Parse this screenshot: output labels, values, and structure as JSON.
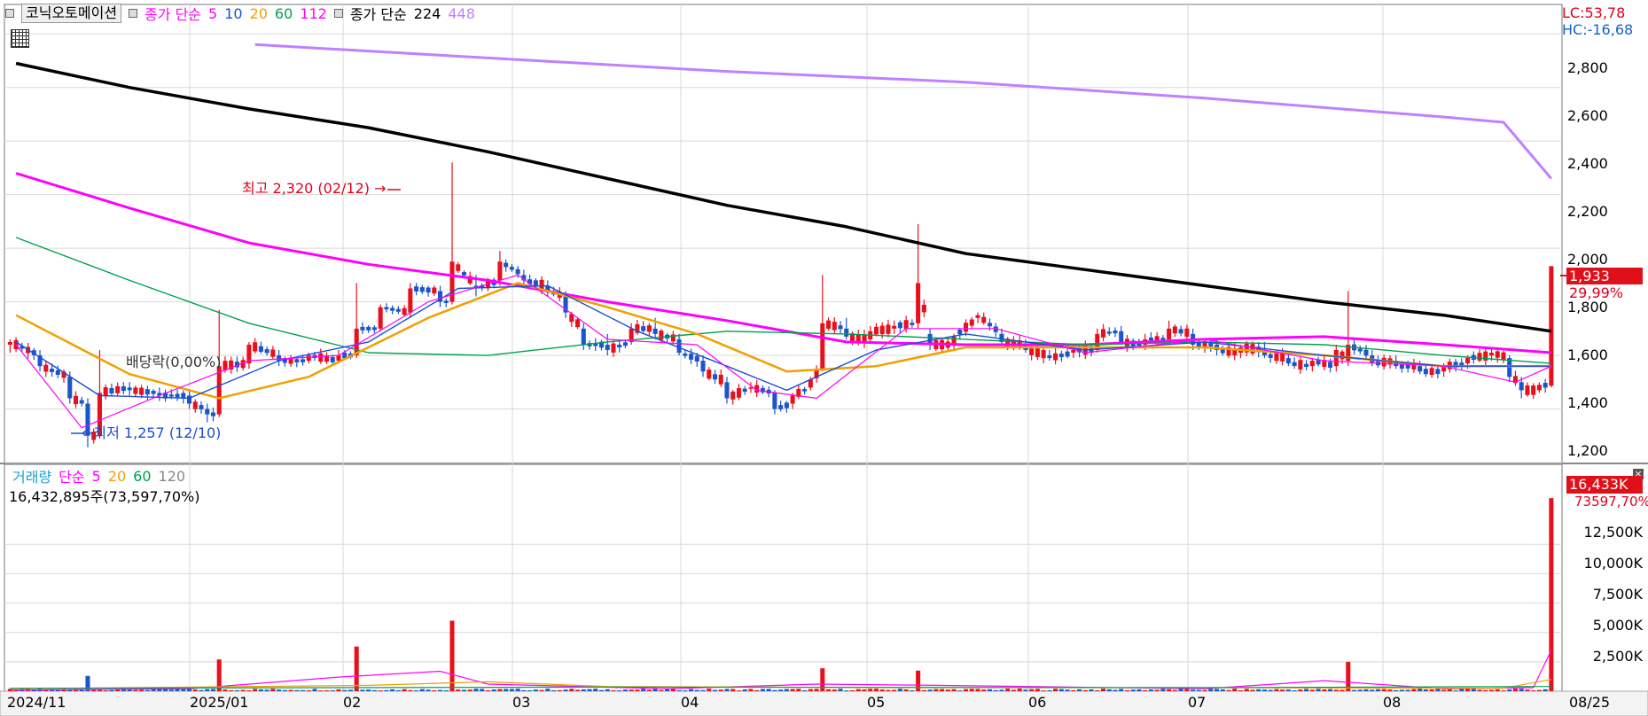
{
  "header": {
    "stock_name": "코닉오토메이션",
    "price_legend": {
      "label": "종가 단순",
      "periods": [
        "5",
        "10",
        "20",
        "60",
        "112"
      ],
      "period_colors": [
        "#ff00ff",
        "#1a4fd6",
        "#f0a000",
        "#00a050",
        "#ff00ff"
      ]
    },
    "price_legend2": {
      "label": "종가 단순",
      "periods": [
        "224",
        "448"
      ],
      "period_colors": [
        "#000000",
        "#c080ff"
      ]
    },
    "lc": "LC:53,78",
    "hc": "HC:-16,68"
  },
  "price_panel": {
    "last_price": "1,933",
    "change_pct": "29,99%",
    "y_ticks": [
      "2,800",
      "2,600",
      "2,400",
      "2,200",
      "2,000",
      "1,800",
      "1,600",
      "1,400",
      "1,200"
    ],
    "annotations": {
      "high": "최고 2,320 (02/12) →",
      "low": "←최저 1,257 (12/10)",
      "dividend": "배당락(0,00%)"
    }
  },
  "volume_panel": {
    "legend_label": "거래량",
    "ma_label": "단순",
    "ma_periods": [
      "5",
      "20",
      "60",
      "120"
    ],
    "ma_colors": [
      "#ff00ff",
      "#f0a000",
      "#00a050",
      "#888888"
    ],
    "info": "16,432,895주(73,597,70%)",
    "last_volume": "16,433K",
    "volume_pct": "73597,70%",
    "y_ticks": [
      "12,500K",
      "10,000K",
      "7,500K",
      "5,000K",
      "2,500K"
    ]
  },
  "x_axis": {
    "labels": [
      "2024/11",
      "2025/01",
      "02",
      "03",
      "04",
      "05",
      "06",
      "07",
      "08",
      "08/25"
    ]
  },
  "colors": {
    "up": "#e8101a",
    "down": "#1a55cc",
    "ma5": "#ff00ff",
    "ma10": "#1a4fd6",
    "ma20": "#f0a000",
    "ma60": "#00a050",
    "ma112": "#ff00ff",
    "ma224": "#000000",
    "ma448": "#c080ff",
    "grid": "#d8d8d8"
  },
  "chart_data": {
    "type": "candlestick",
    "title": "",
    "ylim": [
      1200,
      2900
    ],
    "volume_ylim": [
      0,
      17500
    ],
    "volume_unit": "K",
    "sessions": 205,
    "ohlc_anchors": [
      {
        "i": 0,
        "o": 1640,
        "h": 1660,
        "l": 1610,
        "c": 1650
      },
      {
        "i": 5,
        "o": 1600,
        "h": 1620,
        "l": 1540,
        "c": 1560
      },
      {
        "i": 10,
        "o": 1520,
        "h": 1540,
        "l": 1420,
        "c": 1440
      },
      {
        "i": 13,
        "o": 1420,
        "h": 1440,
        "l": 1257,
        "c": 1300
      },
      {
        "i": 15,
        "o": 1300,
        "h": 1620,
        "l": 1290,
        "c": 1460
      },
      {
        "i": 20,
        "o": 1480,
        "h": 1500,
        "l": 1450,
        "c": 1470
      },
      {
        "i": 25,
        "o": 1460,
        "h": 1480,
        "l": 1430,
        "c": 1450
      },
      {
        "i": 30,
        "o": 1450,
        "h": 1470,
        "l": 1400,
        "c": 1420
      },
      {
        "i": 33,
        "o": 1400,
        "h": 1420,
        "l": 1350,
        "c": 1380
      },
      {
        "i": 35,
        "o": 1380,
        "h": 1770,
        "l": 1370,
        "c": 1560
      },
      {
        "i": 40,
        "o": 1570,
        "h": 1650,
        "l": 1550,
        "c": 1640
      },
      {
        "i": 45,
        "o": 1600,
        "h": 1620,
        "l": 1560,
        "c": 1580
      },
      {
        "i": 50,
        "o": 1580,
        "h": 1610,
        "l": 1570,
        "c": 1600
      },
      {
        "i": 55,
        "o": 1580,
        "h": 1620,
        "l": 1570,
        "c": 1600
      },
      {
        "i": 58,
        "o": 1600,
        "h": 1870,
        "l": 1590,
        "c": 1700
      },
      {
        "i": 62,
        "o": 1700,
        "h": 1790,
        "l": 1690,
        "c": 1780
      },
      {
        "i": 67,
        "o": 1760,
        "h": 1870,
        "l": 1740,
        "c": 1850
      },
      {
        "i": 72,
        "o": 1840,
        "h": 1860,
        "l": 1780,
        "c": 1800
      },
      {
        "i": 74,
        "o": 1800,
        "h": 2320,
        "l": 1790,
        "c": 1950
      },
      {
        "i": 78,
        "o": 1860,
        "h": 1900,
        "l": 1820,
        "c": 1850
      },
      {
        "i": 82,
        "o": 1880,
        "h": 1990,
        "l": 1860,
        "c": 1950
      },
      {
        "i": 86,
        "o": 1900,
        "h": 1920,
        "l": 1860,
        "c": 1880
      },
      {
        "i": 90,
        "o": 1860,
        "h": 1880,
        "l": 1820,
        "c": 1840
      },
      {
        "i": 93,
        "o": 1820,
        "h": 1840,
        "l": 1740,
        "c": 1760
      },
      {
        "i": 96,
        "o": 1700,
        "h": 1720,
        "l": 1620,
        "c": 1640
      },
      {
        "i": 100,
        "o": 1640,
        "h": 1680,
        "l": 1600,
        "c": 1620
      },
      {
        "i": 104,
        "o": 1650,
        "h": 1720,
        "l": 1640,
        "c": 1700
      },
      {
        "i": 108,
        "o": 1700,
        "h": 1740,
        "l": 1660,
        "c": 1680
      },
      {
        "i": 112,
        "o": 1660,
        "h": 1680,
        "l": 1600,
        "c": 1610
      },
      {
        "i": 116,
        "o": 1580,
        "h": 1600,
        "l": 1520,
        "c": 1540
      },
      {
        "i": 120,
        "o": 1500,
        "h": 1520,
        "l": 1420,
        "c": 1440
      },
      {
        "i": 124,
        "o": 1480,
        "h": 1500,
        "l": 1460,
        "c": 1480
      },
      {
        "i": 128,
        "o": 1460,
        "h": 1470,
        "l": 1380,
        "c": 1400
      },
      {
        "i": 131,
        "o": 1420,
        "h": 1460,
        "l": 1400,
        "c": 1450
      },
      {
        "i": 134,
        "o": 1480,
        "h": 1520,
        "l": 1470,
        "c": 1510
      },
      {
        "i": 136,
        "o": 1550,
        "h": 1900,
        "l": 1540,
        "c": 1720
      },
      {
        "i": 140,
        "o": 1700,
        "h": 1740,
        "l": 1660,
        "c": 1670
      },
      {
        "i": 144,
        "o": 1660,
        "h": 1710,
        "l": 1650,
        "c": 1690
      },
      {
        "i": 148,
        "o": 1700,
        "h": 1730,
        "l": 1680,
        "c": 1710
      },
      {
        "i": 152,
        "o": 1720,
        "h": 2090,
        "l": 1700,
        "c": 1870
      },
      {
        "i": 154,
        "o": 1680,
        "h": 1700,
        "l": 1620,
        "c": 1640
      },
      {
        "i": 158,
        "o": 1640,
        "h": 1680,
        "l": 1620,
        "c": 1670
      },
      {
        "i": 162,
        "o": 1740,
        "h": 1760,
        "l": 1720,
        "c": 1750
      },
      {
        "i": 166,
        "o": 1680,
        "h": 1700,
        "l": 1640,
        "c": 1650
      },
      {
        "i": 170,
        "o": 1640,
        "h": 1660,
        "l": 1610,
        "c": 1620
      },
      {
        "i": 174,
        "o": 1600,
        "h": 1620,
        "l": 1580,
        "c": 1590
      },
      {
        "i": 178,
        "o": 1610,
        "h": 1640,
        "l": 1590,
        "c": 1620
      },
      {
        "i": 182,
        "o": 1620,
        "h": 1700,
        "l": 1610,
        "c": 1680
      },
      {
        "i": 186,
        "o": 1690,
        "h": 1710,
        "l": 1640,
        "c": 1650
      },
      {
        "i": 190,
        "o": 1640,
        "h": 1680,
        "l": 1620,
        "c": 1660
      },
      {
        "i": 194,
        "o": 1660,
        "h": 1730,
        "l": 1640,
        "c": 1700
      },
      {
        "i": 198,
        "o": 1680,
        "h": 1700,
        "l": 1620,
        "c": 1640
      },
      {
        "i": 202,
        "o": 1640,
        "h": 1660,
        "l": 1600,
        "c": 1620
      },
      {
        "i": 206,
        "o": 1610,
        "h": 1640,
        "l": 1590,
        "c": 1630
      },
      {
        "i": 210,
        "o": 1620,
        "h": 1650,
        "l": 1590,
        "c": 1600
      },
      {
        "i": 214,
        "o": 1590,
        "h": 1610,
        "l": 1560,
        "c": 1570
      },
      {
        "i": 218,
        "o": 1560,
        "h": 1590,
        "l": 1540,
        "c": 1580
      },
      {
        "i": 222,
        "o": 1560,
        "h": 1640,
        "l": 1540,
        "c": 1620
      },
      {
        "i": 224,
        "o": 1580,
        "h": 1840,
        "l": 1560,
        "c": 1640
      },
      {
        "i": 228,
        "o": 1600,
        "h": 1620,
        "l": 1560,
        "c": 1570
      },
      {
        "i": 232,
        "o": 1580,
        "h": 1600,
        "l": 1550,
        "c": 1560
      },
      {
        "i": 236,
        "o": 1560,
        "h": 1580,
        "l": 1530,
        "c": 1540
      },
      {
        "i": 240,
        "o": 1540,
        "h": 1570,
        "l": 1520,
        "c": 1560
      },
      {
        "i": 244,
        "o": 1570,
        "h": 1600,
        "l": 1550,
        "c": 1590
      },
      {
        "i": 248,
        "o": 1600,
        "h": 1630,
        "l": 1580,
        "c": 1610
      },
      {
        "i": 251,
        "o": 1590,
        "h": 1600,
        "l": 1500,
        "c": 1520
      },
      {
        "i": 253,
        "o": 1500,
        "h": 1520,
        "l": 1440,
        "c": 1470
      },
      {
        "i": 256,
        "o": 1470,
        "h": 1500,
        "l": 1460,
        "c": 1490
      },
      {
        "i": 258,
        "o": 1487,
        "h": 1933,
        "l": 1480,
        "c": 1933
      }
    ],
    "volume_spikes": [
      {
        "i": 13,
        "v": 1300
      },
      {
        "i": 35,
        "v": 2700
      },
      {
        "i": 58,
        "v": 3800
      },
      {
        "i": 74,
        "v": 6000
      },
      {
        "i": 136,
        "v": 1950
      },
      {
        "i": 152,
        "v": 1750
      },
      {
        "i": 224,
        "v": 2500
      },
      {
        "i": 258,
        "v": 16433
      }
    ],
    "ma_lines": {
      "ma448": [
        [
          41,
          2760
        ],
        [
          80,
          2710
        ],
        [
          120,
          2660
        ],
        [
          160,
          2620
        ],
        [
          200,
          2560
        ],
        [
          240,
          2490
        ],
        [
          250,
          2470
        ],
        [
          258,
          2260
        ]
      ],
      "ma224": [
        [
          1,
          2690
        ],
        [
          20,
          2600
        ],
        [
          40,
          2520
        ],
        [
          60,
          2450
        ],
        [
          80,
          2360
        ],
        [
          100,
          2260
        ],
        [
          120,
          2160
        ],
        [
          140,
          2080
        ],
        [
          160,
          1980
        ],
        [
          180,
          1920
        ],
        [
          200,
          1860
        ],
        [
          220,
          1800
        ],
        [
          240,
          1750
        ],
        [
          258,
          1690
        ]
      ],
      "ma112": [
        [
          1,
          2280
        ],
        [
          20,
          2150
        ],
        [
          40,
          2020
        ],
        [
          60,
          1940
        ],
        [
          80,
          1880
        ],
        [
          100,
          1800
        ],
        [
          120,
          1730
        ],
        [
          140,
          1650
        ],
        [
          160,
          1640
        ],
        [
          180,
          1640
        ],
        [
          200,
          1660
        ],
        [
          220,
          1670
        ],
        [
          240,
          1640
        ],
        [
          258,
          1610
        ]
      ],
      "ma60": [
        [
          1,
          2040
        ],
        [
          20,
          1880
        ],
        [
          40,
          1720
        ],
        [
          60,
          1610
        ],
        [
          80,
          1600
        ],
        [
          100,
          1650
        ],
        [
          120,
          1690
        ],
        [
          140,
          1680
        ],
        [
          160,
          1660
        ],
        [
          180,
          1640
        ],
        [
          200,
          1650
        ],
        [
          220,
          1640
        ],
        [
          240,
          1600
        ],
        [
          258,
          1570
        ]
      ],
      "ma20": [
        [
          1,
          1750
        ],
        [
          20,
          1530
        ],
        [
          35,
          1440
        ],
        [
          50,
          1520
        ],
        [
          70,
          1740
        ],
        [
          85,
          1870
        ],
        [
          100,
          1780
        ],
        [
          115,
          1680
        ],
        [
          130,
          1540
        ],
        [
          145,
          1560
        ],
        [
          160,
          1630
        ],
        [
          180,
          1630
        ],
        [
          200,
          1630
        ],
        [
          220,
          1600
        ],
        [
          240,
          1560
        ],
        [
          258,
          1560
        ]
      ],
      "ma10": [
        [
          1,
          1650
        ],
        [
          15,
          1450
        ],
        [
          30,
          1440
        ],
        [
          45,
          1580
        ],
        [
          60,
          1650
        ],
        [
          75,
          1850
        ],
        [
          90,
          1860
        ],
        [
          105,
          1690
        ],
        [
          120,
          1560
        ],
        [
          130,
          1470
        ],
        [
          145,
          1620
        ],
        [
          160,
          1680
        ],
        [
          180,
          1620
        ],
        [
          200,
          1650
        ],
        [
          220,
          1600
        ],
        [
          240,
          1560
        ],
        [
          258,
          1560
        ]
      ],
      "ma5": [
        [
          1,
          1640
        ],
        [
          12,
          1330
        ],
        [
          25,
          1450
        ],
        [
          40,
          1580
        ],
        [
          55,
          1600
        ],
        [
          70,
          1800
        ],
        [
          85,
          1900
        ],
        [
          100,
          1660
        ],
        [
          115,
          1640
        ],
        [
          125,
          1470
        ],
        [
          135,
          1440
        ],
        [
          150,
          1700
        ],
        [
          165,
          1700
        ],
        [
          180,
          1610
        ],
        [
          200,
          1660
        ],
        [
          220,
          1580
        ],
        [
          240,
          1560
        ],
        [
          252,
          1500
        ],
        [
          258,
          1560
        ]
      ]
    },
    "volume_ma": {
      "ma5": [
        [
          0,
          100
        ],
        [
          30,
          200
        ],
        [
          55,
          1200
        ],
        [
          72,
          1700
        ],
        [
          80,
          600
        ],
        [
          110,
          200
        ],
        [
          135,
          600
        ],
        [
          155,
          500
        ],
        [
          200,
          200
        ],
        [
          220,
          900
        ],
        [
          240,
          200
        ],
        [
          255,
          300
        ],
        [
          258,
          3500
        ]
      ],
      "ma20": [
        [
          0,
          200
        ],
        [
          60,
          500
        ],
        [
          80,
          800
        ],
        [
          100,
          400
        ],
        [
          150,
          300
        ],
        [
          200,
          300
        ],
        [
          250,
          250
        ],
        [
          258,
          1000
        ]
      ],
      "ma60": [
        [
          0,
          250
        ],
        [
          100,
          350
        ],
        [
          200,
          300
        ],
        [
          258,
          400
        ]
      ]
    }
  }
}
